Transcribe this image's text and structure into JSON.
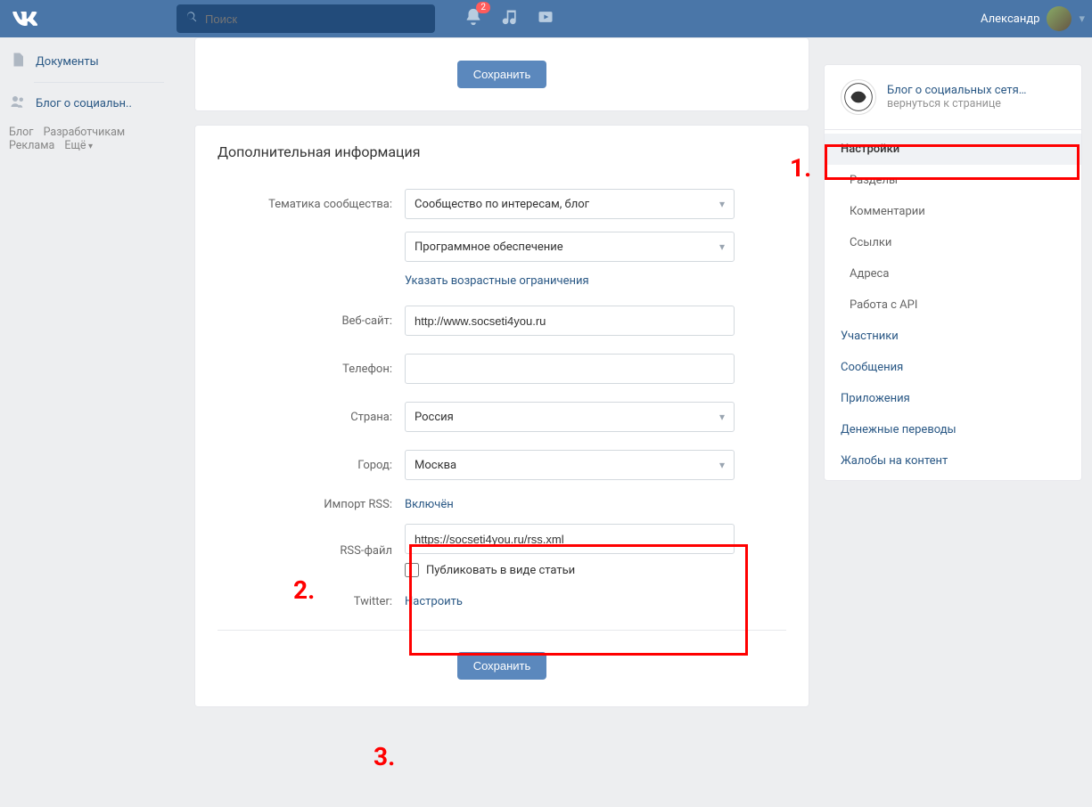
{
  "header": {
    "search_placeholder": "Поиск",
    "badge_count": "2",
    "username": "Александр"
  },
  "left_nav": {
    "items": [
      {
        "label": "Документы"
      },
      {
        "label": "Блог о социальн.."
      }
    ],
    "bottom_links": {
      "blog": "Блог",
      "developers": "Разработчикам",
      "ads": "Реклама",
      "more": "Ещё"
    }
  },
  "main": {
    "top_save_label": "Сохранить",
    "section_title": "Дополнительная информация",
    "fields": {
      "topic_label": "Тематика сообщества:",
      "topic_value": "Сообщество по интересам, блог",
      "topic_value2": "Программное обеспечение",
      "age_link": "Указать возрастные ограничения",
      "website_label": "Веб-сайт:",
      "website_value": "http://www.socseti4you.ru",
      "phone_label": "Телефон:",
      "phone_value": "",
      "country_label": "Страна:",
      "country_value": "Россия",
      "city_label": "Город:",
      "city_value": "Москва",
      "rss_import_label": "Импорт RSS:",
      "rss_import_value": "Включён",
      "rss_file_label": "RSS-файл",
      "rss_file_value": "https://socseti4you.ru/rss.xml",
      "rss_publish_label": "Публиковать в виде статьи",
      "twitter_label": "Twitter:",
      "twitter_value": "Настроить"
    },
    "bottom_save_label": "Сохранить"
  },
  "right": {
    "community_title": "Блог о социальных сетя…",
    "community_back": "вернуться к странице",
    "menu": {
      "settings": "Настройки",
      "sections": "Разделы",
      "comments": "Комментарии",
      "links": "Ссылки",
      "addresses": "Адреса",
      "api": "Работа с API",
      "members": "Участники",
      "messages": "Сообщения",
      "apps": "Приложения",
      "money": "Денежные переводы",
      "complaints": "Жалобы на контент"
    }
  },
  "annotations": {
    "one": "1.",
    "two": "2.",
    "three": "3."
  }
}
